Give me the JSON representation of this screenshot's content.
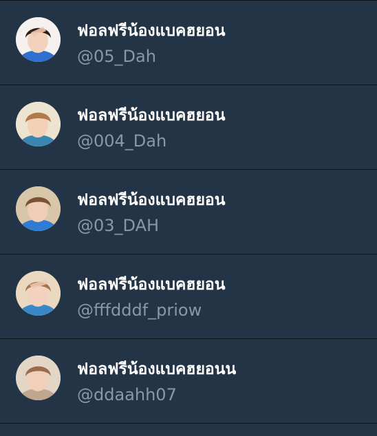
{
  "accounts": [
    {
      "name": "ฟอลฟรีน้องแบคฮยอน",
      "handle": "@05_Dah",
      "avatar": {
        "icon": "profile-photo",
        "bg": "#f4f1ee",
        "hair": "#2c1d17",
        "skin": "#f3d2bd",
        "shirt": "#2f6fd0"
      }
    },
    {
      "name": "ฟอลฟรีน้องแบคฮยอน",
      "handle": "@004_Dah",
      "avatar": {
        "icon": "profile-photo",
        "bg": "#ece3d0",
        "hair": "#b07a4b",
        "skin": "#f2d1b8",
        "shirt": "#3a86b0"
      }
    },
    {
      "name": "ฟอลฟรีน้องแบคฮยอน",
      "handle": "@03_DAH",
      "avatar": {
        "icon": "profile-photo",
        "bg": "#d8c6a9",
        "hair": "#7a5335",
        "skin": "#efcdb6",
        "shirt": "#2e7cd3"
      }
    },
    {
      "name": "ฟอลฟรีน้องแบคฮยอน",
      "handle": "@fffdddf_priow",
      "avatar": {
        "icon": "profile-photo",
        "bg": "#ead8c0",
        "hair": "#a6734a",
        "skin": "#f2d2bf",
        "shirt": "#3a87c7"
      }
    },
    {
      "name": "ฟอลฟรีน้องแบคฮยอนน",
      "handle": "@ddaahh07",
      "avatar": {
        "icon": "profile-photo",
        "bg": "#e3d6c7",
        "hair": "#9c6b4a",
        "skin": "#f0cfbb",
        "shirt": "#c0a58f"
      }
    }
  ]
}
